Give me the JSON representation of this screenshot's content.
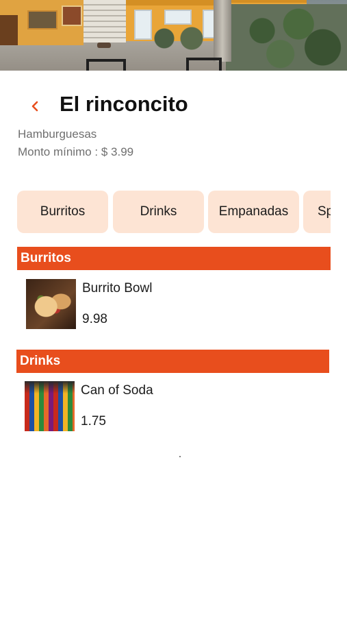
{
  "header": {
    "title": "El rinconcito",
    "back_icon": "chevron-left-icon"
  },
  "restaurant": {
    "category": "Hamburguesas",
    "min_amount": "Monto mínimo : $ 3.99"
  },
  "category_tabs": [
    "Burritos",
    "Drinks",
    "Empanadas",
    "Sp"
  ],
  "sections": [
    {
      "title": "Burritos",
      "items": [
        {
          "name": "Burrito Bowl",
          "price": "9.98",
          "image_icon": "burrito-bowl-photo"
        }
      ]
    },
    {
      "title": "Drinks",
      "items": [
        {
          "name": "Can of Soda",
          "price": "1.75",
          "image_icon": "soda-bottles-photo"
        }
      ]
    }
  ],
  "colors": {
    "accent": "#e84e1d",
    "chip_background": "#fde4d4",
    "muted_text": "#6f6f6f"
  }
}
